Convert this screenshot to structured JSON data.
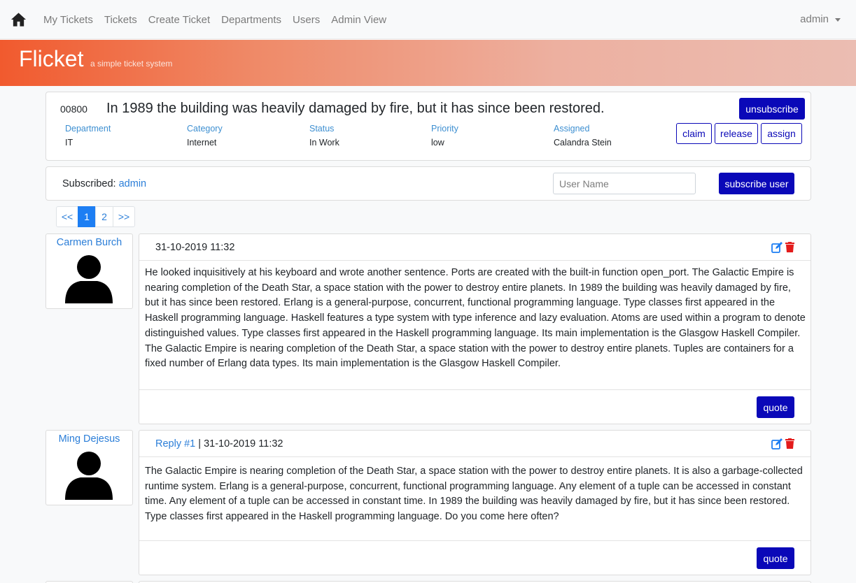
{
  "navbar": {
    "home_icon": "home-icon",
    "links": [
      "My Tickets",
      "Tickets",
      "Create Ticket",
      "Departments",
      "Users",
      "Admin View"
    ],
    "user": "admin"
  },
  "banner": {
    "brand": "Flicket",
    "tagline": "a simple ticket system"
  },
  "ticket": {
    "id": "00800",
    "title": "In 1989 the building was heavily damaged by fire, but it has since been restored.",
    "fields": [
      {
        "label": "Department",
        "value": "IT"
      },
      {
        "label": "Category",
        "value": "Internet"
      },
      {
        "label": "Status",
        "value": "In Work"
      },
      {
        "label": "Priority",
        "value": "low"
      },
      {
        "label": "Assigned",
        "value": "Calandra Stein"
      }
    ],
    "buttons": {
      "unsubscribe": "unsubscribe",
      "claim": "claim",
      "release": "release",
      "assign": "assign"
    }
  },
  "subscription": {
    "label": "Subscribed:",
    "user": "admin",
    "input_placeholder": "User Name",
    "button": "subscribe user"
  },
  "pagination": {
    "first": "<<",
    "pages": [
      "1",
      "2"
    ],
    "active": "1",
    "last": ">>"
  },
  "posts": [
    {
      "author": "Carmen Burch",
      "reply_label": "",
      "date": "31-10-2019 11:32",
      "body": "He looked inquisitively at his keyboard and wrote another sentence. Ports are created with the built-in function open_port. The Galactic Empire is nearing completion of the Death Star, a space station with the power to destroy entire planets. In 1989 the building was heavily damaged by fire, but it has since been restored. Erlang is a general-purpose, concurrent, functional programming language. Type classes first appeared in the Haskell programming language. Haskell features a type system with type inference and lazy evaluation. Atoms are used within a program to denote distinguished values. Type classes first appeared in the Haskell programming language. Its main implementation is the Glasgow Haskell Compiler. The Galactic Empire is nearing completion of the Death Star, a space station with the power to destroy entire planets. Tuples are containers for a fixed number of Erlang data types. Its main implementation is the Glasgow Haskell Compiler.",
      "quote": "quote"
    },
    {
      "author": "Ming Dejesus",
      "reply_label": "Reply #1",
      "date": "31-10-2019 11:32",
      "body": "The Galactic Empire is nearing completion of the Death Star, a space station with the power to destroy entire planets. It is also a garbage-collected runtime system. Erlang is a general-purpose, concurrent, functional programming language. Any element of a tuple can be accessed in constant time. Any element of a tuple can be accessed in constant time. In 1989 the building was heavily damaged by fire, but it has since been restored. Type classes first appeared in the Haskell programming language. Do you come here often?",
      "quote": "quote"
    }
  ],
  "colors": {
    "accent": "#0a08b8",
    "link": "#2b7ed8",
    "banner_start": "#f15a2e",
    "delete": "#e31b1b"
  }
}
